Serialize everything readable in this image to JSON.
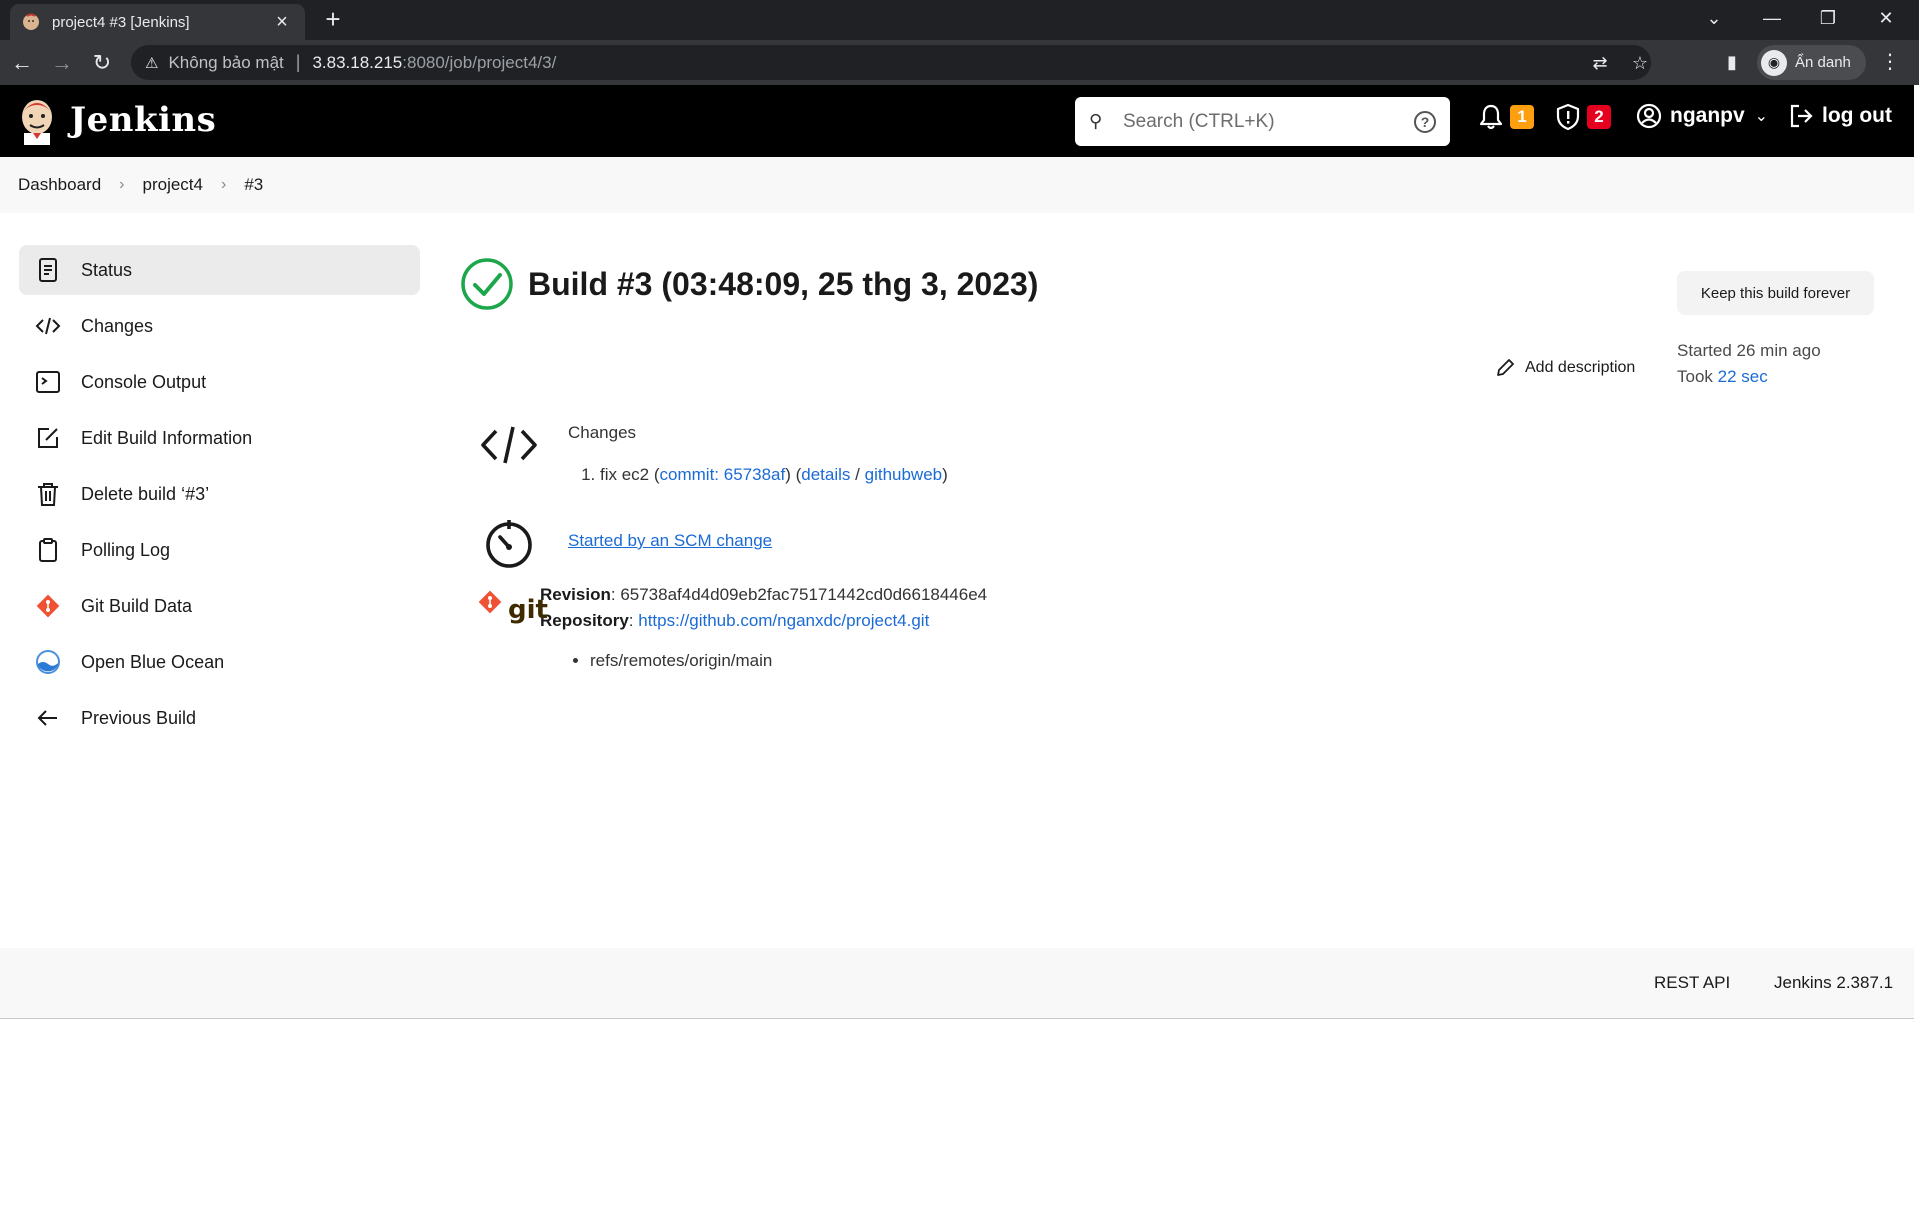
{
  "browser": {
    "tab_title": "project4 #3 [Jenkins]",
    "tab_close": "×",
    "new_tab": "+",
    "security_label": "Không bảo mật",
    "url_host": "3.83.18.215",
    "url_path": ":8080/job/project4/3/",
    "profile_label": "Ẩn danh"
  },
  "header": {
    "brand": "Jenkins",
    "search_placeholder": "Search (CTRL+K)",
    "notifications_count": "1",
    "security_count": "2",
    "user_name": "nganpv",
    "logout_label": "log out"
  },
  "breadcrumb": {
    "items": [
      "Dashboard",
      "project4",
      "#3"
    ]
  },
  "sidebar": {
    "items": [
      {
        "label": "Status",
        "icon": "status-icon"
      },
      {
        "label": "Changes",
        "icon": "code-icon"
      },
      {
        "label": "Console Output",
        "icon": "terminal-icon"
      },
      {
        "label": "Edit Build Information",
        "icon": "edit-icon"
      },
      {
        "label": "Delete build ‘#3’",
        "icon": "trash-icon"
      },
      {
        "label": "Polling Log",
        "icon": "clipboard-icon"
      },
      {
        "label": "Git Build Data",
        "icon": "git-icon"
      },
      {
        "label": "Open Blue Ocean",
        "icon": "blue-ocean-icon"
      },
      {
        "label": "Previous Build",
        "icon": "arrow-left-icon"
      }
    ],
    "active_index": 0
  },
  "build": {
    "title": "Build #3 (03:48:09, 25 thg 3, 2023)",
    "status": "success",
    "keep_forever_label": "Keep this build forever",
    "started_text": "Started 26 min ago",
    "took_prefix": "Took ",
    "took_value": "22 sec",
    "add_description_label": "Add description"
  },
  "changes": {
    "heading": "Changes",
    "items": [
      {
        "message": "fix ec2",
        "commit_label": "commit: 65738af",
        "details_label": "details",
        "sep": "/",
        "githubweb_label": "githubweb"
      }
    ]
  },
  "cause": {
    "text": "Started by an SCM change"
  },
  "git": {
    "revision_label": "Revision",
    "revision": "65738af4d4d09eb2fac75171442cd0d6618446e4",
    "repository_label": "Repository",
    "repository": "https://github.com/nganxdc/project4.git",
    "refs": [
      "refs/remotes/origin/main"
    ],
    "logo_text": "git"
  },
  "footer": {
    "rest_api": "REST API",
    "version": "Jenkins 2.387.1"
  },
  "colors": {
    "link": "#1b6bd6",
    "success": "#1ea64b",
    "badge_orange": "#fe9f10",
    "badge_red": "#e6001f",
    "git_orange": "#f05133"
  }
}
